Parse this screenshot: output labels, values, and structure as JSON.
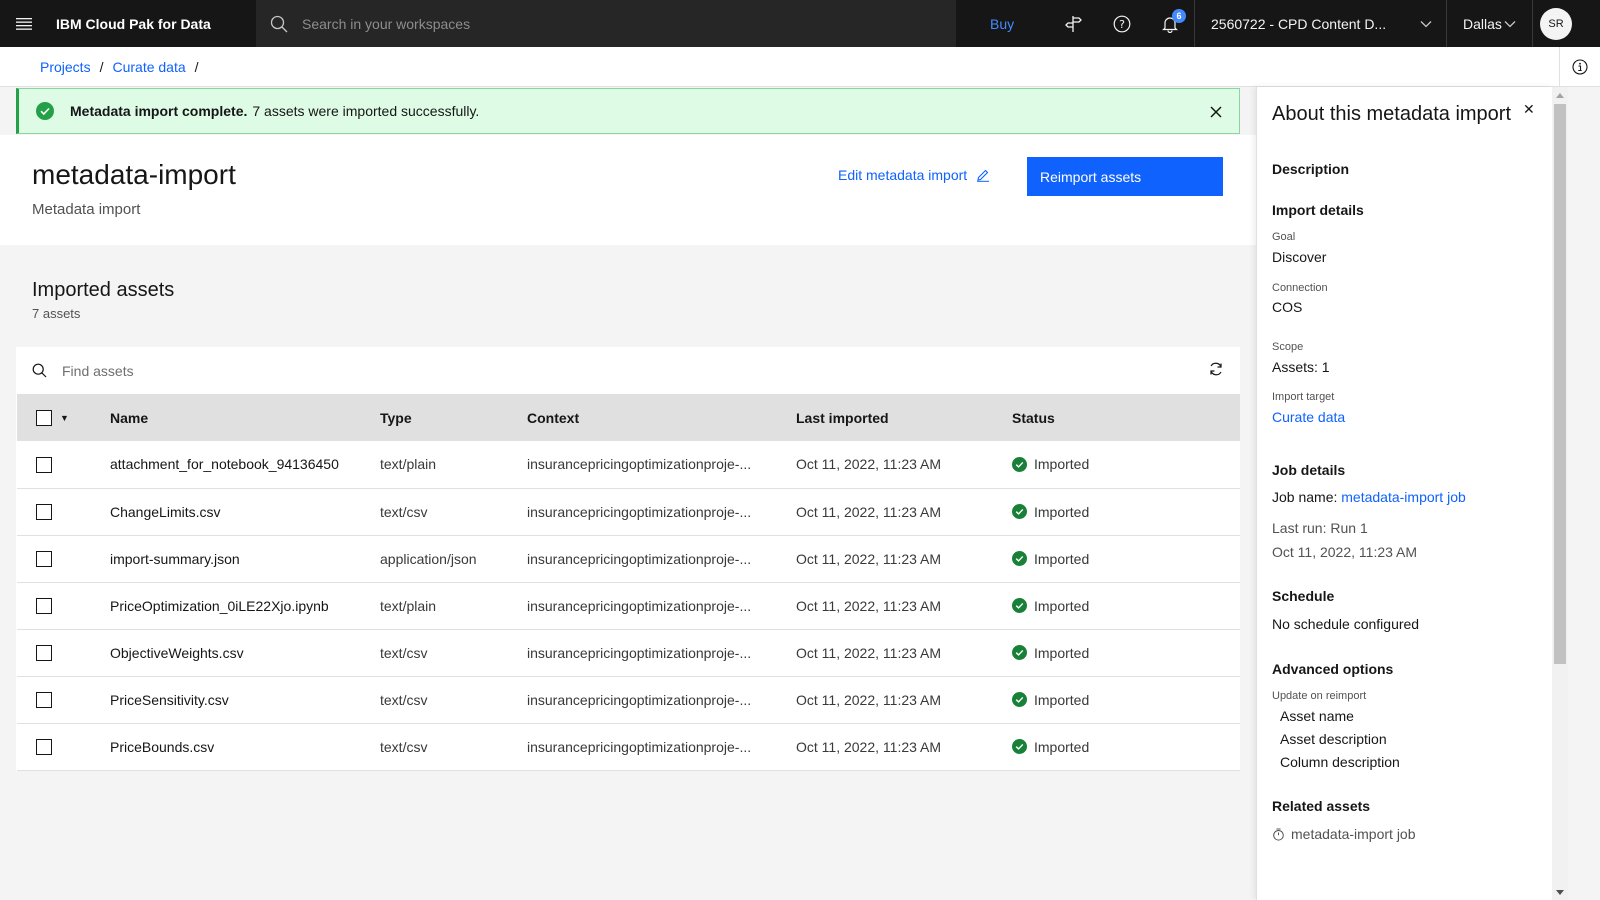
{
  "header": {
    "brand": "IBM Cloud Pak for Data",
    "search_placeholder": "Search in your workspaces",
    "buy_label": "Buy",
    "notification_count": "6",
    "account": "2560722 - CPD Content D...",
    "region": "Dallas",
    "avatar_initials": "SR"
  },
  "breadcrumb": {
    "items": [
      "Projects",
      "Curate data"
    ],
    "separator": "/"
  },
  "toast": {
    "title": "Metadata import complete.",
    "message": "7 assets were imported successfully."
  },
  "page": {
    "title": "metadata-import",
    "subtitle": "Metadata import",
    "edit_label": "Edit metadata import",
    "reimport_label": "Reimport assets"
  },
  "assets": {
    "title": "Imported assets",
    "count": "7 assets",
    "search_placeholder": "Find assets",
    "columns": [
      "Name",
      "Type",
      "Context",
      "Last imported",
      "Status"
    ],
    "rows": [
      {
        "name": "attachment_for_notebook_94136450",
        "type": "text/plain",
        "context": "insurancepricingoptimizationproje-...",
        "last_imported": "Oct 11, 2022, 11:23 AM",
        "status": "Imported"
      },
      {
        "name": "ChangeLimits.csv",
        "type": "text/csv",
        "context": "insurancepricingoptimizationproje-...",
        "last_imported": "Oct 11, 2022, 11:23 AM",
        "status": "Imported"
      },
      {
        "name": "import-summary.json",
        "type": "application/json",
        "context": "insurancepricingoptimizationproje-...",
        "last_imported": "Oct 11, 2022, 11:23 AM",
        "status": "Imported"
      },
      {
        "name": "PriceOptimization_0iLE22Xjo.ipynb",
        "type": "text/plain",
        "context": "insurancepricingoptimizationproje-...",
        "last_imported": "Oct 11, 2022, 11:23 AM",
        "status": "Imported"
      },
      {
        "name": "ObjectiveWeights.csv",
        "type": "text/csv",
        "context": "insurancepricingoptimizationproje-...",
        "last_imported": "Oct 11, 2022, 11:23 AM",
        "status": "Imported"
      },
      {
        "name": "PriceSensitivity.csv",
        "type": "text/csv",
        "context": "insurancepricingoptimizationproje-...",
        "last_imported": "Oct 11, 2022, 11:23 AM",
        "status": "Imported"
      },
      {
        "name": "PriceBounds.csv",
        "type": "text/csv",
        "context": "insurancepricingoptimizationproje-...",
        "last_imported": "Oct 11, 2022, 11:23 AM",
        "status": "Imported"
      }
    ]
  },
  "side_panel": {
    "title": "About this metadata import",
    "description_heading": "Description",
    "import_details_heading": "Import details",
    "goal_label": "Goal",
    "goal_value": "Discover",
    "connection_label": "Connection",
    "connection_value": "COS",
    "scope_label": "Scope",
    "scope_value": "Assets: 1",
    "target_label": "Import target",
    "target_value": "Curate data",
    "job_details_heading": "Job details",
    "job_name_label": "Job name:",
    "job_name_value": "metadata-import job",
    "last_run": "Last run: Run 1",
    "last_run_time": "Oct 11, 2022, 11:23 AM",
    "schedule_heading": "Schedule",
    "schedule_value": "No schedule configured",
    "advanced_heading": "Advanced options",
    "update_label": "Update on reimport",
    "update_items": [
      "Asset name",
      "Asset description",
      "Column description"
    ],
    "related_heading": "Related assets",
    "related_item": "metadata-import job"
  },
  "colors": {
    "primary": "#0f62fe",
    "success": "#24a148",
    "toast_bg": "#defbe6",
    "header_bg": "#161616"
  }
}
